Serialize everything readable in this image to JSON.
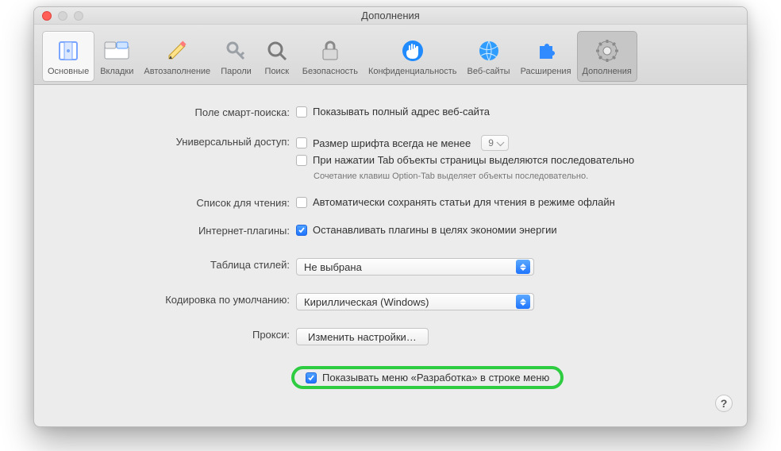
{
  "window": {
    "title": "Дополнения"
  },
  "toolbar": {
    "items": [
      {
        "id": "general",
        "label": "Основные"
      },
      {
        "id": "tabs",
        "label": "Вкладки"
      },
      {
        "id": "autofill",
        "label": "Автозаполнение"
      },
      {
        "id": "passwords",
        "label": "Пароли"
      },
      {
        "id": "search",
        "label": "Поиск"
      },
      {
        "id": "security",
        "label": "Безопасность"
      },
      {
        "id": "privacy",
        "label": "Конфиденциальность"
      },
      {
        "id": "websites",
        "label": "Веб-сайты"
      },
      {
        "id": "extensions",
        "label": "Расширения"
      },
      {
        "id": "advanced",
        "label": "Дополнения"
      }
    ]
  },
  "sections": {
    "smart_search": {
      "label": "Поле смарт-поиска:",
      "cb1": "Показывать полный адрес веб-сайта",
      "cb1_checked": false
    },
    "universal_access": {
      "label": "Универсальный доступ:",
      "cb1": "Размер шрифта всегда не менее",
      "cb1_checked": false,
      "min_font": "9",
      "cb2": "При нажатии Tab объекты страницы выделяются последовательно",
      "cb2_checked": false,
      "hint": "Сочетание клавиш Option-Tab выделяет объекты последовательно."
    },
    "reading_list": {
      "label": "Список для чтения:",
      "cb1": "Автоматически сохранять статьи для чтения в режиме офлайн",
      "cb1_checked": false
    },
    "plugins": {
      "label": "Интернет-плагины:",
      "cb1": "Останавливать плагины в целях экономии энергии",
      "cb1_checked": true
    },
    "stylesheet": {
      "label": "Таблица стилей:",
      "value": "Не выбрана"
    },
    "encoding": {
      "label": "Кодировка по умолчанию:",
      "value": "Кириллическая (Windows)"
    },
    "proxies": {
      "label": "Прокси:",
      "button": "Изменить настройки…"
    },
    "develop": {
      "cb1": "Показывать меню «Разработка» в строке меню",
      "cb1_checked": true
    }
  },
  "help": "?"
}
